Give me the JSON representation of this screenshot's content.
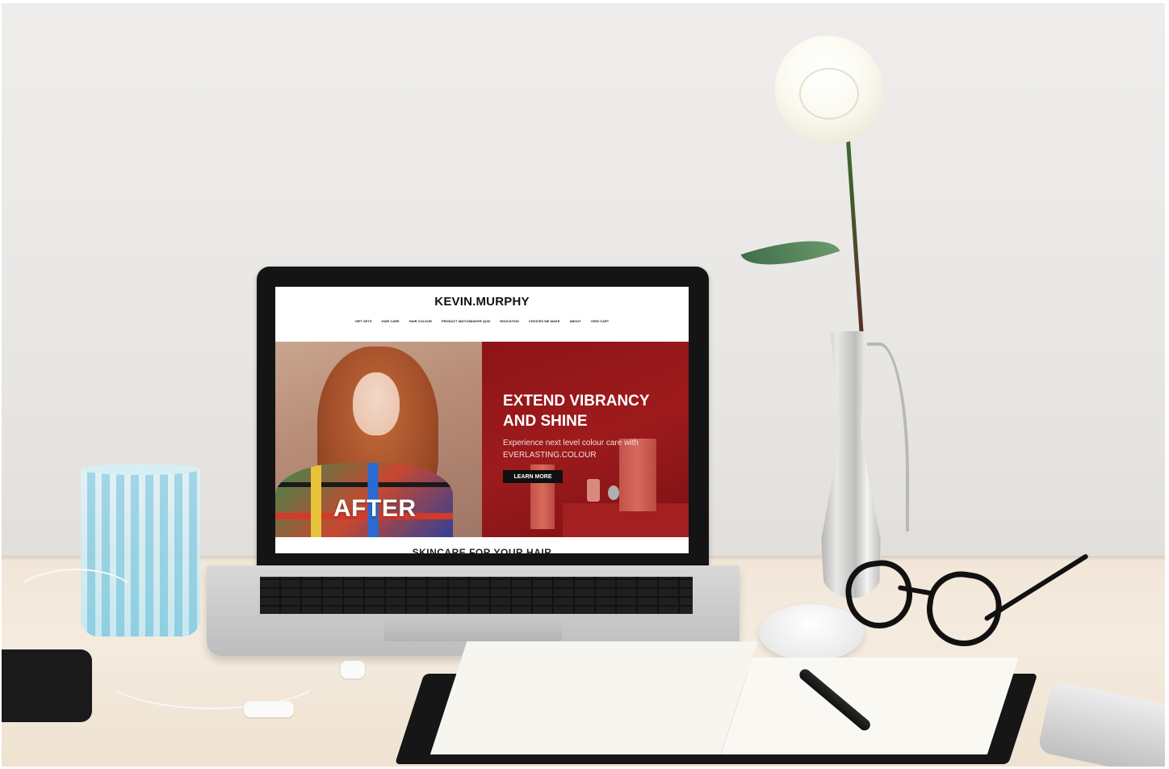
{
  "website": {
    "logo": "KEVIN.MURPHY",
    "nav": [
      "GIFT SETS",
      "HAIR CARE",
      "HAIR COLOUR",
      "PRODUCT MATCHMAKER QUIZ",
      "EDUCATION",
      "CHOICES WE MAKE",
      "ABOUT",
      "VIEW CART"
    ],
    "hero": {
      "image_caption": "AFTER",
      "title_line1": "EXTEND VIBRANCY",
      "title_line2": "AND SHINE",
      "text_line1": "Experience next level colour care with",
      "text_line2": "EVERLASTING.COLOUR",
      "cta": "LEARN MORE"
    },
    "next_section_title": "SKINCARE FOR YOUR HAIR"
  },
  "colors": {
    "hero_red": "#9e1b1d",
    "cta_background": "#0f0f0f"
  }
}
